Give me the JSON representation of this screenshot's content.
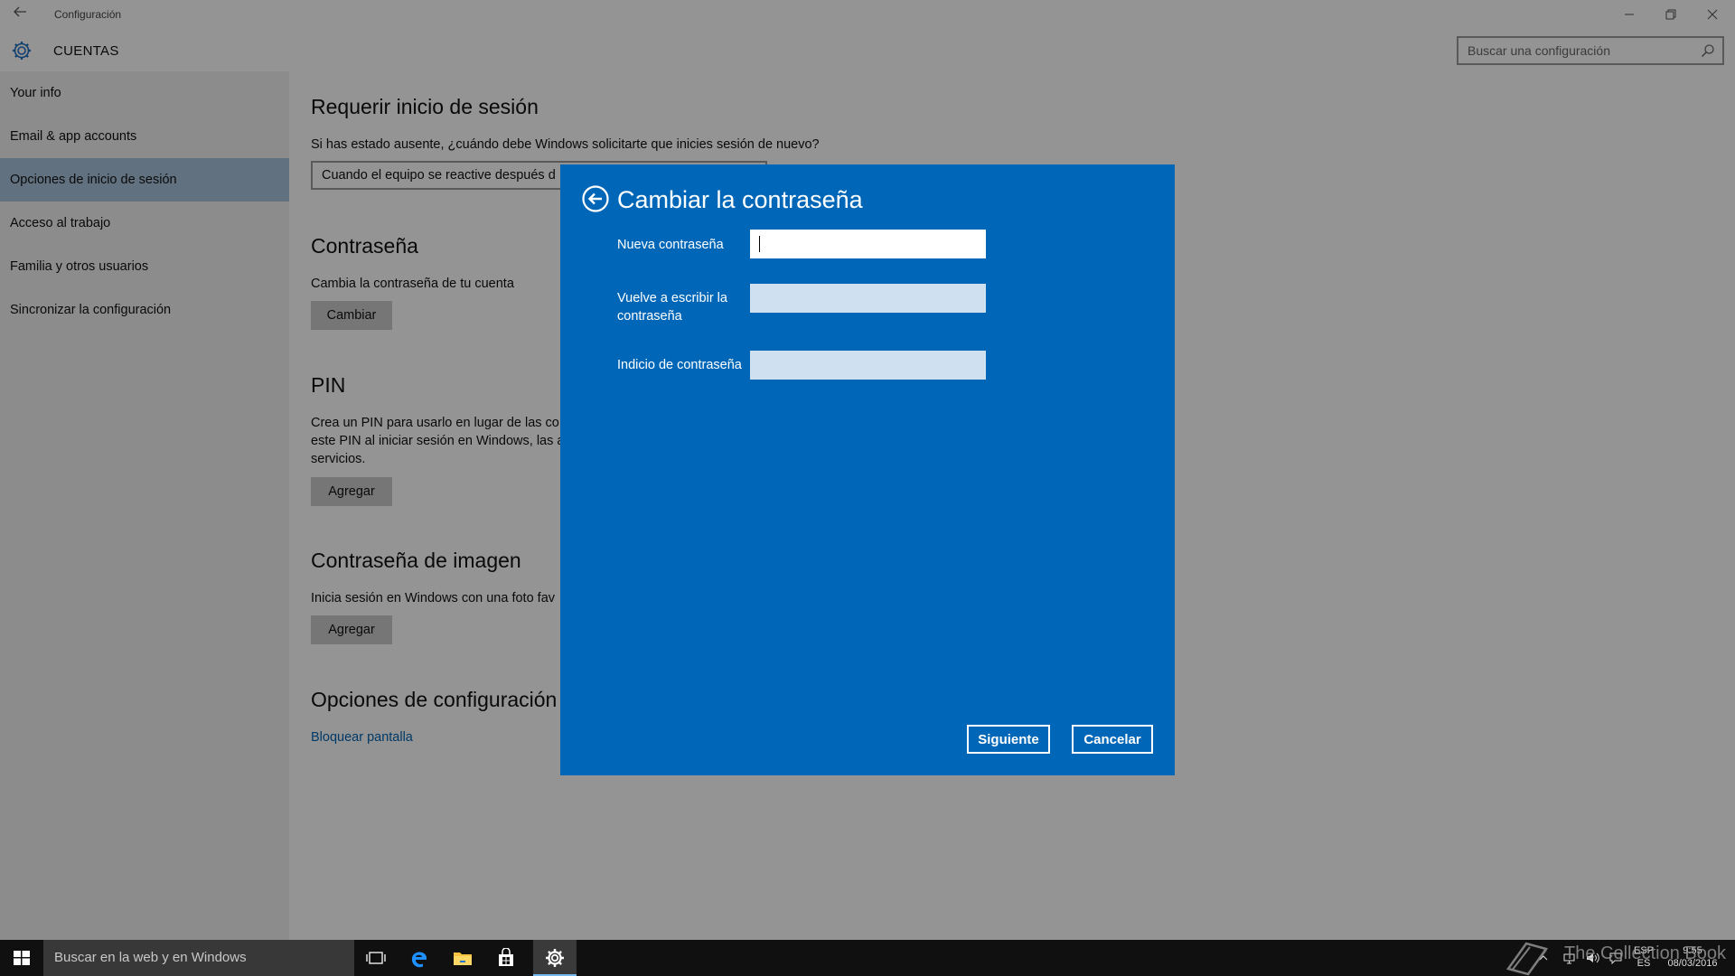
{
  "window": {
    "title": "Configuración",
    "app_title": "CUENTAS",
    "search_placeholder": "Buscar una configuración"
  },
  "sidebar": {
    "items": [
      {
        "label": "Your info"
      },
      {
        "label": "Email & app accounts"
      },
      {
        "label": "Opciones de inicio de sesión",
        "active": true
      },
      {
        "label": "Acceso al trabajo"
      },
      {
        "label": "Familia y otros usuarios"
      },
      {
        "label": "Sincronizar la configuración"
      }
    ]
  },
  "content": {
    "require_signin": {
      "heading": "Requerir inicio de sesión",
      "question": "Si has estado ausente, ¿cuándo debe Windows solicitarte que inicies sesión de nuevo?",
      "dropdown_value": "Cuando el equipo se reactive después d"
    },
    "password": {
      "heading": "Contraseña",
      "text": "Cambia la contraseña de tu cuenta",
      "button": "Cambiar"
    },
    "pin": {
      "heading": "PIN",
      "line1": "Crea un PIN para usarlo en lugar de las co",
      "line2": "este PIN al iniciar sesión en Windows, las a",
      "line3": "servicios.",
      "button": "Agregar"
    },
    "picture_password": {
      "heading": "Contraseña de imagen",
      "text": "Inicia sesión en Windows con una foto fav",
      "button": "Agregar"
    },
    "related": {
      "heading": "Opciones de configuración",
      "link": "Bloquear pantalla"
    }
  },
  "dialog": {
    "title": "Cambiar la contraseña",
    "fields": [
      {
        "label": "Nueva contraseña",
        "value": ""
      },
      {
        "label": "Vuelve a escribir la contraseña",
        "value": ""
      },
      {
        "label": "Indicio de contraseña",
        "value": ""
      }
    ],
    "next_button": "Siguiente",
    "cancel_button": "Cancelar"
  },
  "taskbar": {
    "search_placeholder": "Buscar en la web y en Windows",
    "language": "ESP",
    "language_sub": "ES",
    "time": "9:55",
    "date": "08/03/2016"
  },
  "watermark": "The Collection Book",
  "colors": {
    "accent": "#0067b8",
    "sidebar_active": "#a9c3dc",
    "link": "#0063b1",
    "taskbar": "#101010"
  }
}
